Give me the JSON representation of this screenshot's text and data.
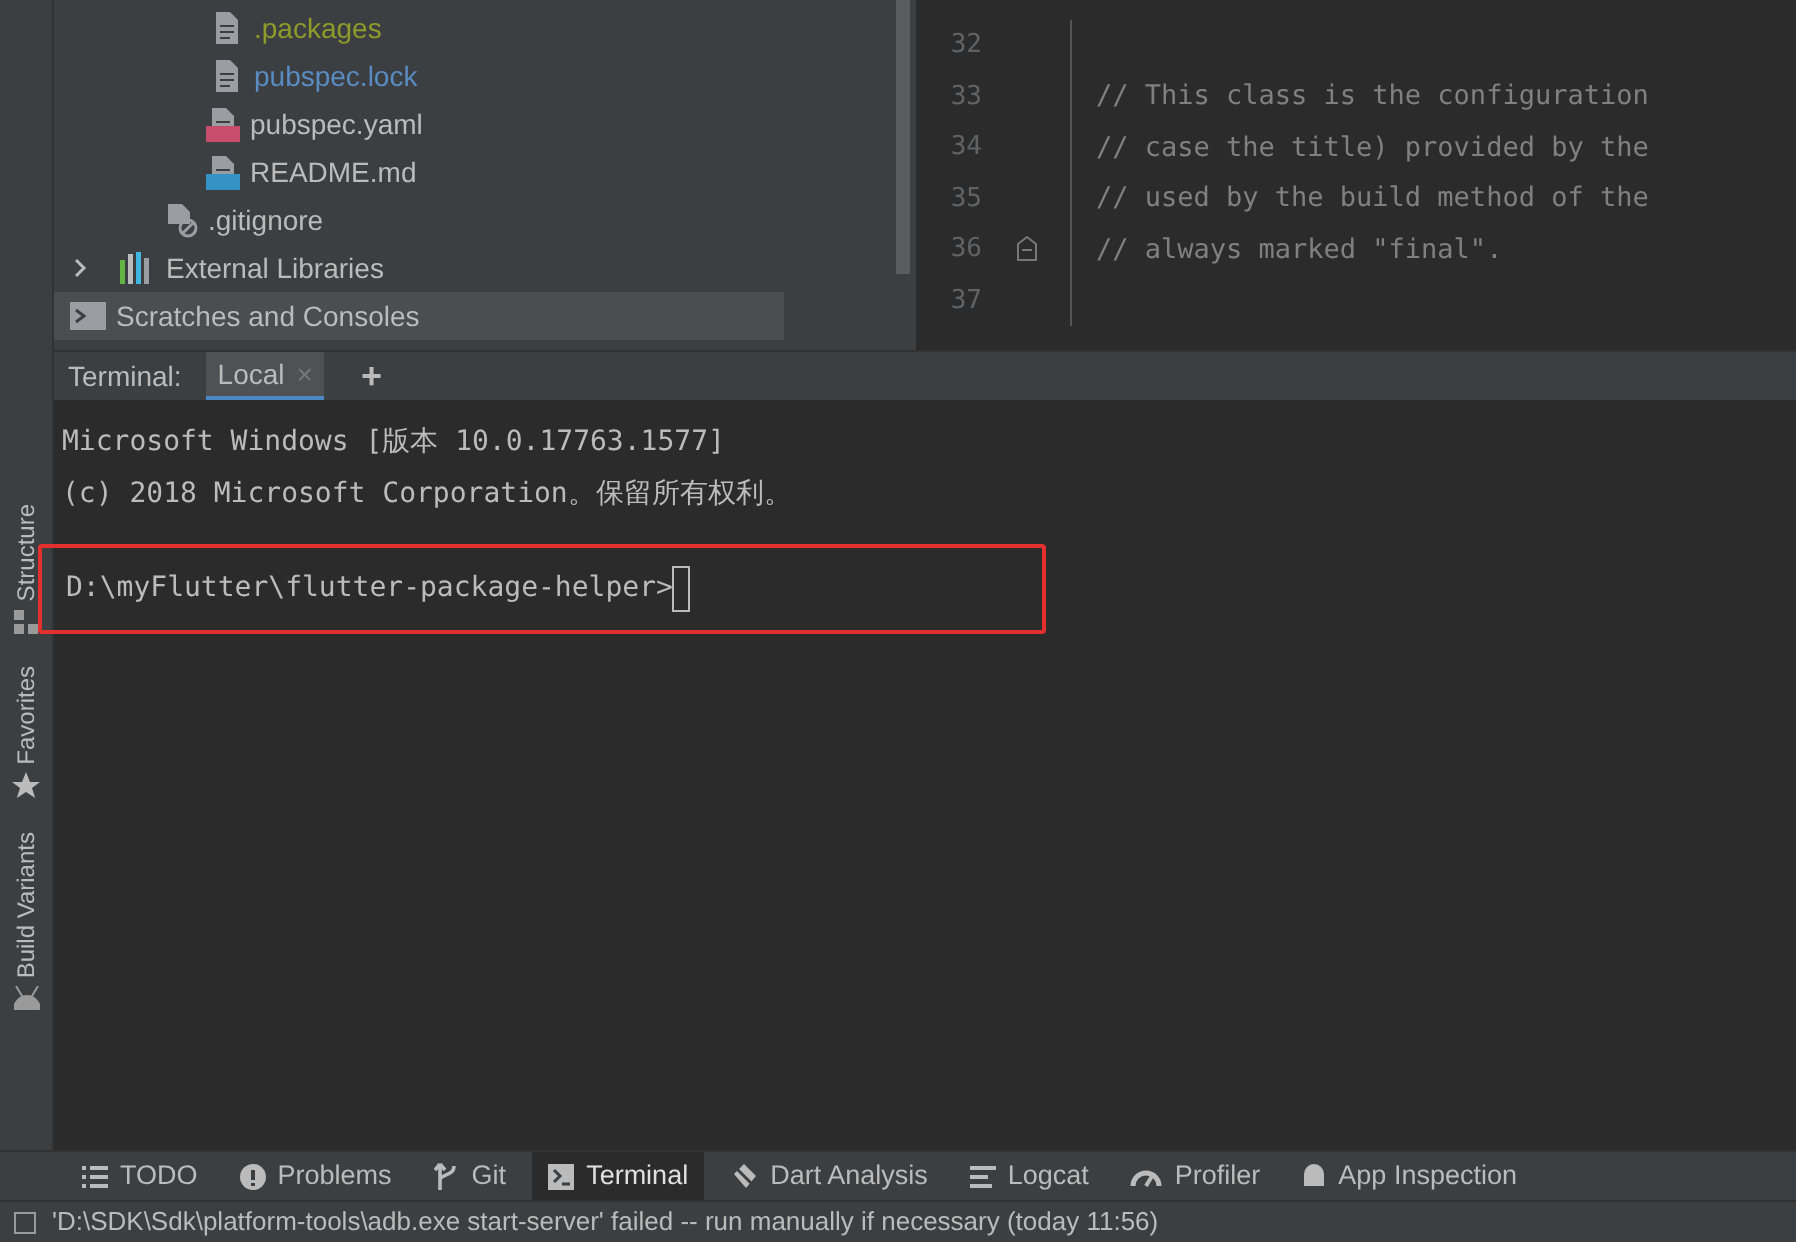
{
  "side_tabs": [
    {
      "label": "Structure",
      "kind": "structure"
    },
    {
      "label": "Favorites",
      "kind": "star"
    },
    {
      "label": "Build Variants",
      "kind": "android"
    }
  ],
  "project_tree": [
    {
      "label": ".packages",
      "kind": "file",
      "color": "#8f9a2b",
      "selected": false
    },
    {
      "label": "pubspec.lock",
      "kind": "file",
      "color": "#5a8bc1",
      "selected": false
    },
    {
      "label": "pubspec.yaml",
      "kind": "yaml",
      "color": "#bbbbbb",
      "selected": false
    },
    {
      "label": "README.md",
      "kind": "md",
      "color": "#bbbbbb",
      "selected": false
    },
    {
      "label": ".gitignore",
      "kind": "ignored",
      "color": "#bbbbbb",
      "selected": false
    },
    {
      "label": "External Libraries",
      "kind": "library",
      "color": "#bbbbbb",
      "expanded": false,
      "selected": false
    },
    {
      "label": "Scratches and Consoles",
      "kind": "scratch",
      "color": "#bbbbbb",
      "selected": true
    }
  ],
  "editor": {
    "lines": [
      {
        "number": "32"
      },
      {
        "number": "33",
        "text": "// This class is the configuration"
      },
      {
        "number": "34",
        "text": "// case the title) provided by the"
      },
      {
        "number": "35",
        "text": "// used by the build method of the"
      },
      {
        "number": "36",
        "text": "// always marked \"final\".",
        "fold": true
      },
      {
        "number": "37"
      }
    ]
  },
  "terminal": {
    "label": "Terminal:",
    "tabs": [
      {
        "label": "Local",
        "selected": true,
        "close": "×"
      }
    ],
    "add": "+",
    "lines": [
      "Microsoft Windows [版本 10.0.17763.1577]",
      "(c) 2018 Microsoft Corporation。保留所有权利。"
    ],
    "prompt": "D:\\myFlutter\\flutter-package-helper>",
    "highlighted": true
  },
  "tool_tabs": [
    {
      "label": "TODO",
      "kind": "list",
      "selected": false
    },
    {
      "label": "Problems",
      "kind": "alert",
      "selected": false
    },
    {
      "label": "Git",
      "kind": "git",
      "selected": false
    },
    {
      "label": "Terminal",
      "kind": "terminal",
      "selected": true
    },
    {
      "label": "Dart Analysis",
      "kind": "dart",
      "selected": false
    },
    {
      "label": "Logcat",
      "kind": "logcat",
      "selected": false
    },
    {
      "label": "Profiler",
      "kind": "gauge",
      "selected": false
    },
    {
      "label": "App Inspection",
      "kind": "inspect",
      "selected": false
    }
  ],
  "status_bar": {
    "message": "'D:\\SDK\\Sdk\\platform-tools\\adb.exe start-server' failed -- run manually if necessary (today 11:56)"
  }
}
